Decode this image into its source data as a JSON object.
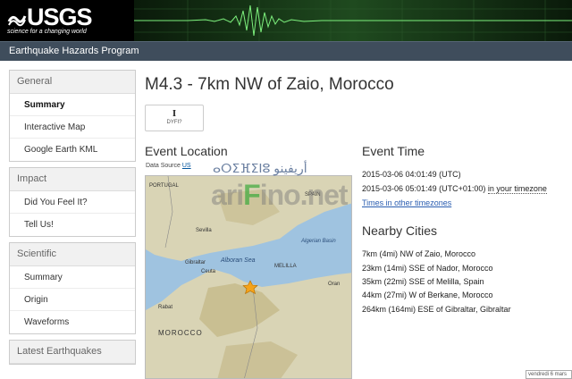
{
  "header": {
    "logo_text": "USGS",
    "logo_tagline": "science for a changing world",
    "program_title": "Earthquake Hazards Program"
  },
  "sidebar": {
    "groups": [
      {
        "title": "General",
        "items": [
          {
            "label": "Summary"
          },
          {
            "label": "Interactive Map"
          },
          {
            "label": "Google Earth KML"
          }
        ]
      },
      {
        "title": "Impact",
        "items": [
          {
            "label": "Did You Feel It?"
          },
          {
            "label": "Tell Us!"
          }
        ]
      },
      {
        "title": "Scientific",
        "items": [
          {
            "label": "Summary"
          },
          {
            "label": "Origin"
          },
          {
            "label": "Waveforms"
          }
        ]
      },
      {
        "title": "Latest Earthquakes",
        "items": []
      }
    ]
  },
  "main": {
    "title": "M4.3 - 7km NW of Zaio, Morocco",
    "dyfi": {
      "value": "I",
      "label": "DYFI?"
    },
    "event_location": {
      "heading": "Event Location",
      "source_label": "Data Source",
      "source_link": "US"
    },
    "event_time": {
      "heading": "Event Time",
      "utc": "2015-03-06 04:01:49 (UTC)",
      "local": "2015-03-06 05:01:49 (UTC+01:00)",
      "local_tz_link": "in your timezone",
      "other_tz_link": "Times in other timezones"
    },
    "nearby_cities": {
      "heading": "Nearby Cities",
      "items": [
        "7km (4mi) NW of Zaio, Morocco",
        "23km (14mi) SSE of Nador, Morocco",
        "35km (22mi) SSE of Melilla, Spain",
        "44km (27mi) W of Berkane, Morocco",
        "264km (164mi) ESE of Gibraltar, Gibraltar"
      ]
    }
  },
  "map": {
    "labels": {
      "portugal": "PORTUGAL",
      "spain": "SPAIN",
      "sevilla": "Sevilla",
      "gibraltar": "Gibraltar",
      "ceuta": "Ceuta",
      "alboran": "Alboran Sea",
      "melilla": "MELILLA",
      "algerian_basin": "Algerian Basin",
      "oran": "Oran",
      "rabat": "Rabat",
      "morocco": "MOROCCO"
    },
    "colors": {
      "water": "#9fc3e0",
      "land": "#d9d4b5",
      "mountain": "#c4b98a",
      "marker": "#f5a31a"
    }
  },
  "watermark": {
    "arabic": "ⴰⵔⵉⴼⵉⵏⵓ أريفينو",
    "main_a": "ari",
    "main_f": "F",
    "main_b": "ino.net"
  },
  "corner_tag": "vendredi 6 mars"
}
